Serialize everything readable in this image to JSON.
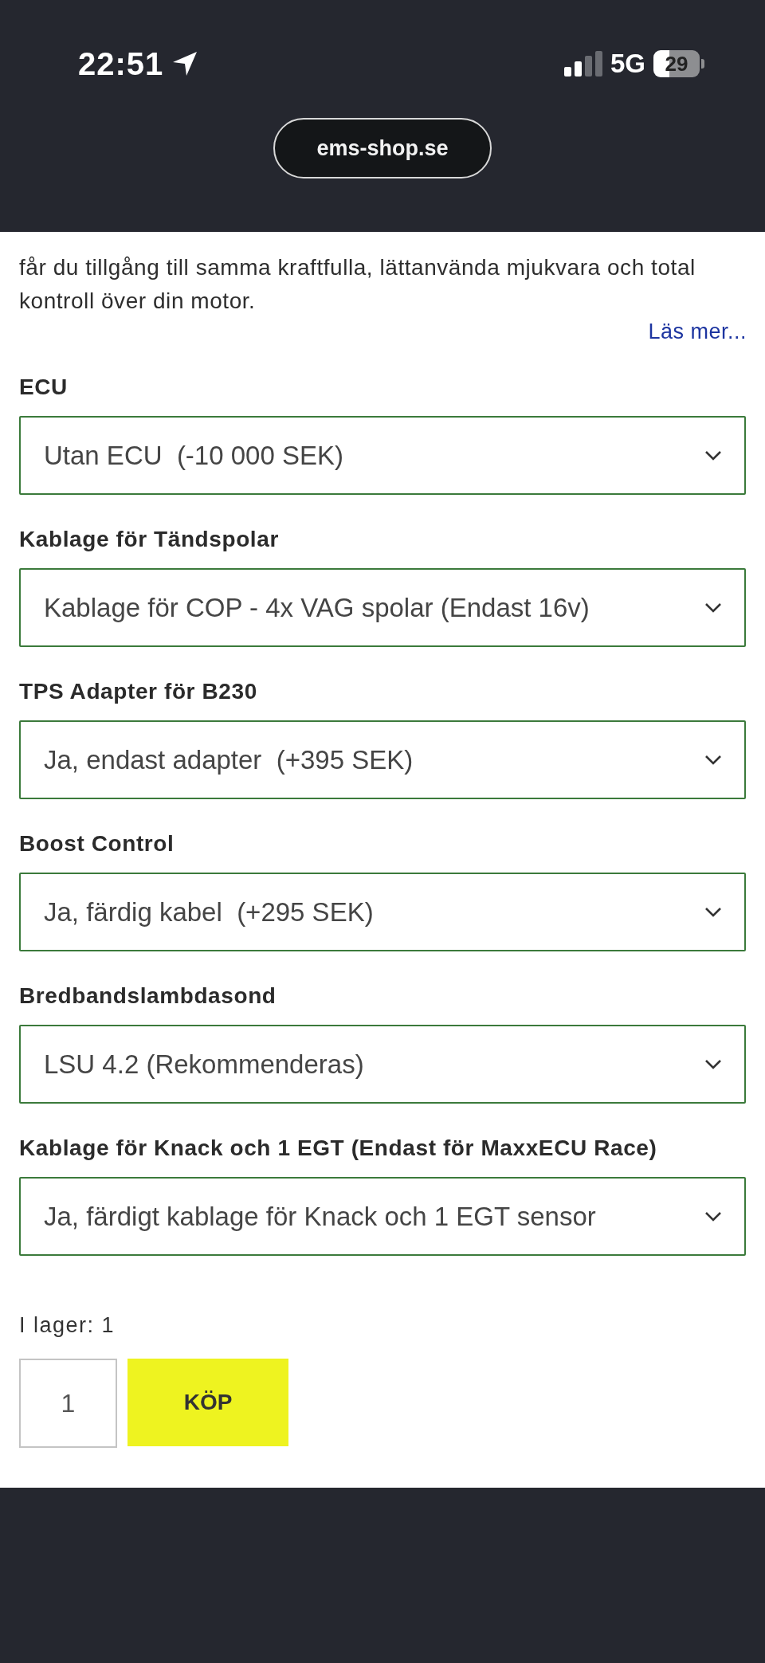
{
  "status_bar": {
    "time": "22:51",
    "network": "5G",
    "battery": "29"
  },
  "address_bar": {
    "url": "ems-shop.se"
  },
  "description": {
    "text": "får du tillgång till samma kraftfulla, lättanvända mjukvara och total kontroll över din motor.",
    "read_more": "Läs mer..."
  },
  "options": [
    {
      "label": "ECU",
      "value": "Utan ECU  (-10 000 SEK)"
    },
    {
      "label": "Kablage för Tändspolar",
      "value": "Kablage för COP - 4x VAG spolar (Endast 16v)"
    },
    {
      "label": "TPS Adapter för B230",
      "value": "Ja, endast adapter  (+395 SEK)"
    },
    {
      "label": "Boost Control",
      "value": "Ja, färdig kabel  (+295 SEK)"
    },
    {
      "label": "Bredbandslambdasond",
      "value": "LSU 4.2 (Rekommenderas)"
    },
    {
      "label": "Kablage för Knack och 1 EGT (Endast för MaxxECU Race)",
      "value": "Ja, färdigt kablage för Knack och 1 EGT sensor"
    }
  ],
  "stock": "I lager: 1",
  "quantity": "1",
  "buy_button": "KÖP"
}
